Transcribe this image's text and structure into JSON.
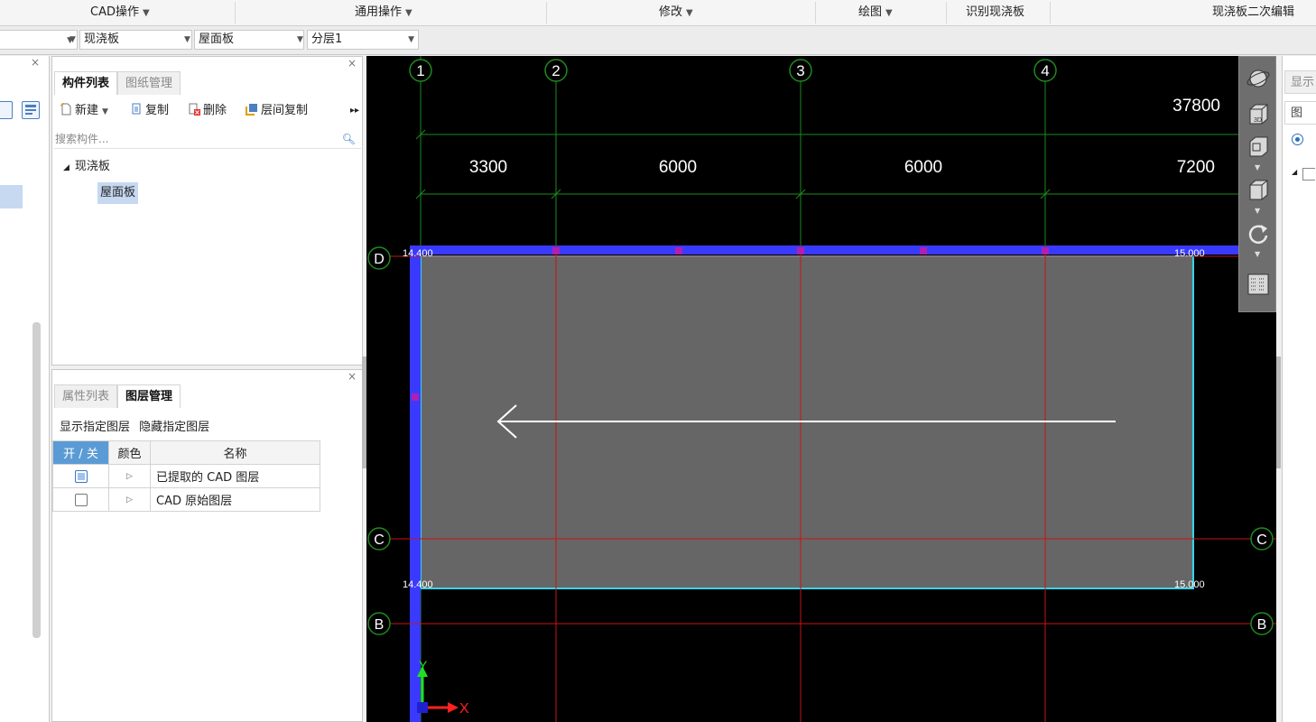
{
  "ribbon": {
    "items": [
      {
        "label": "CAD操作",
        "caret": true
      },
      {
        "label": "通用操作",
        "caret": true
      },
      {
        "label": "修改",
        "caret": true
      },
      {
        "label": "绘图",
        "caret": true
      },
      {
        "label": "识别现浇板",
        "caret": false
      },
      {
        "label": "现浇板二次编辑",
        "caret": false
      }
    ]
  },
  "toolbar2": {
    "dropdown1": "",
    "dropdown2": "现浇板",
    "dropdown3": "屋面板",
    "dropdown4": "分层1"
  },
  "component_panel": {
    "tabs": [
      "构件列表",
      "图纸管理"
    ],
    "actions": {
      "new": "新建",
      "copy": "复制",
      "delete": "删除",
      "floor_copy": "层间复制"
    },
    "search_placeholder": "搜索构件...",
    "tree": {
      "parent": "现浇板",
      "child": "屋面板"
    }
  },
  "layer_panel": {
    "tabs": [
      "属性列表",
      "图层管理"
    ],
    "show_layer": "显示指定图层",
    "hide_layer": "隐藏指定图层",
    "columns": [
      "开 / 关",
      "颜色",
      "名称"
    ],
    "rows": [
      {
        "on": true,
        "name": "已提取的 CAD 图层"
      },
      {
        "on": false,
        "name": "CAD 原始图层"
      }
    ]
  },
  "drawing": {
    "axes_x": [
      "1",
      "2",
      "3",
      "4"
    ],
    "axes_y": [
      "D",
      "C",
      "B"
    ],
    "axes_y_right": [
      "C",
      "B"
    ],
    "total_dimension": "37800",
    "segment_dimensions": [
      "3300",
      "6000",
      "6000",
      "7200"
    ],
    "elevation_top_left": "14.400",
    "elevation_top_right": "15.000",
    "elevation_bottom_left": "14.400",
    "elevation_bottom_right": "15.000",
    "ucs_y": "Y",
    "ucs_x": "X"
  },
  "right_panel": {
    "tabs": [
      "显示",
      "图"
    ]
  },
  "colors": {
    "grid_green": "#1e8a1e",
    "axis_red": "#c81414",
    "beam_blue": "#3a3aff",
    "slab_fill": "#666666",
    "slab_edge": "#39d4e8",
    "accent": "#5b9bd5"
  }
}
